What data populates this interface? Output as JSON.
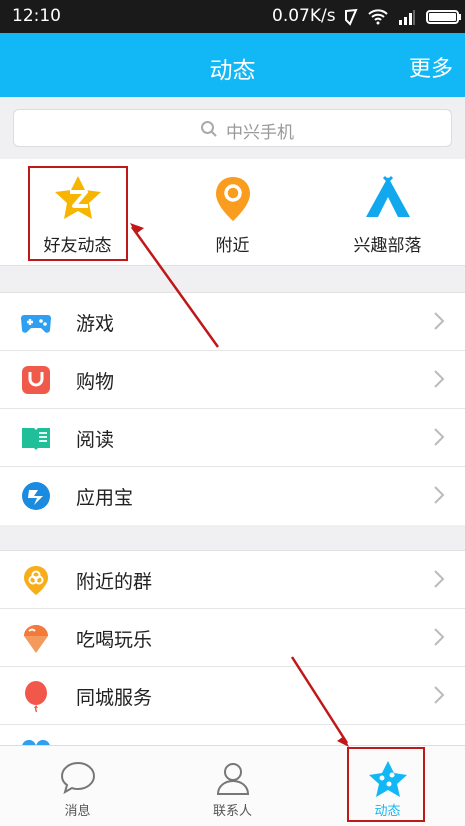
{
  "status": {
    "time": "12:10",
    "net_speed": "0.07K/s"
  },
  "header": {
    "title": "动态",
    "more": "更多"
  },
  "search": {
    "placeholder": "中兴手机"
  },
  "quick": [
    {
      "label": "好友动态",
      "icon": "qzone-star-icon"
    },
    {
      "label": "附近",
      "icon": "location-pin-icon"
    },
    {
      "label": "兴趣部落",
      "icon": "tent-icon"
    }
  ],
  "section1": [
    {
      "label": "游戏",
      "icon": "gamepad-icon"
    },
    {
      "label": "购物",
      "icon": "shopping-bag-icon"
    },
    {
      "label": "阅读",
      "icon": "book-icon"
    },
    {
      "label": "应用宝",
      "icon": "app-store-icon"
    }
  ],
  "section2": [
    {
      "label": "附近的群",
      "icon": "nearby-groups-icon"
    },
    {
      "label": "吃喝玩乐",
      "icon": "ice-cream-icon"
    },
    {
      "label": "同城服务",
      "icon": "balloon-icon"
    }
  ],
  "tabs": [
    {
      "label": "消息",
      "icon": "chat-bubble-icon"
    },
    {
      "label": "联系人",
      "icon": "contacts-icon"
    },
    {
      "label": "动态",
      "icon": "star-icon",
      "active": true
    }
  ],
  "colors": {
    "brand": "#12b7f5",
    "highlight": "#c01818"
  }
}
